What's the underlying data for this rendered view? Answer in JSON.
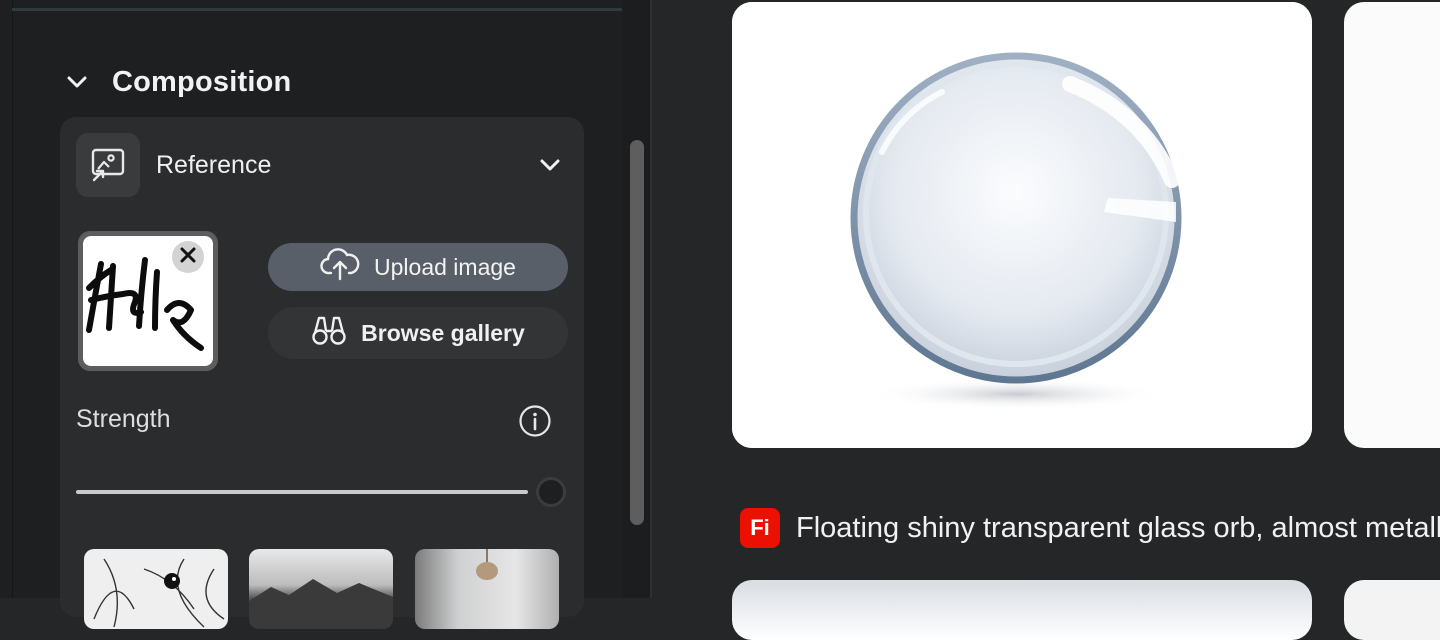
{
  "left_panel": {
    "section": {
      "title": "Composition",
      "expanded": true
    },
    "reference": {
      "label": "Reference",
      "thumbnail_text": "Hello",
      "upload_label": "Upload image",
      "browse_label": "Browse gallery"
    },
    "strength": {
      "label": "Strength",
      "value": 1.0
    },
    "gallery": [
      "sketch-bird",
      "mountain-landscape",
      "interior-lamp"
    ]
  },
  "results": {
    "prompt_badge": "Fi",
    "prompt_text": "Floating shiny transparent glass orb, almost metallic"
  },
  "colors": {
    "accent_badge": "#eb1000",
    "panel_bg": "#1e1f20",
    "card_bg": "#2b2c2e",
    "upload_button_bg": "#595f69"
  }
}
